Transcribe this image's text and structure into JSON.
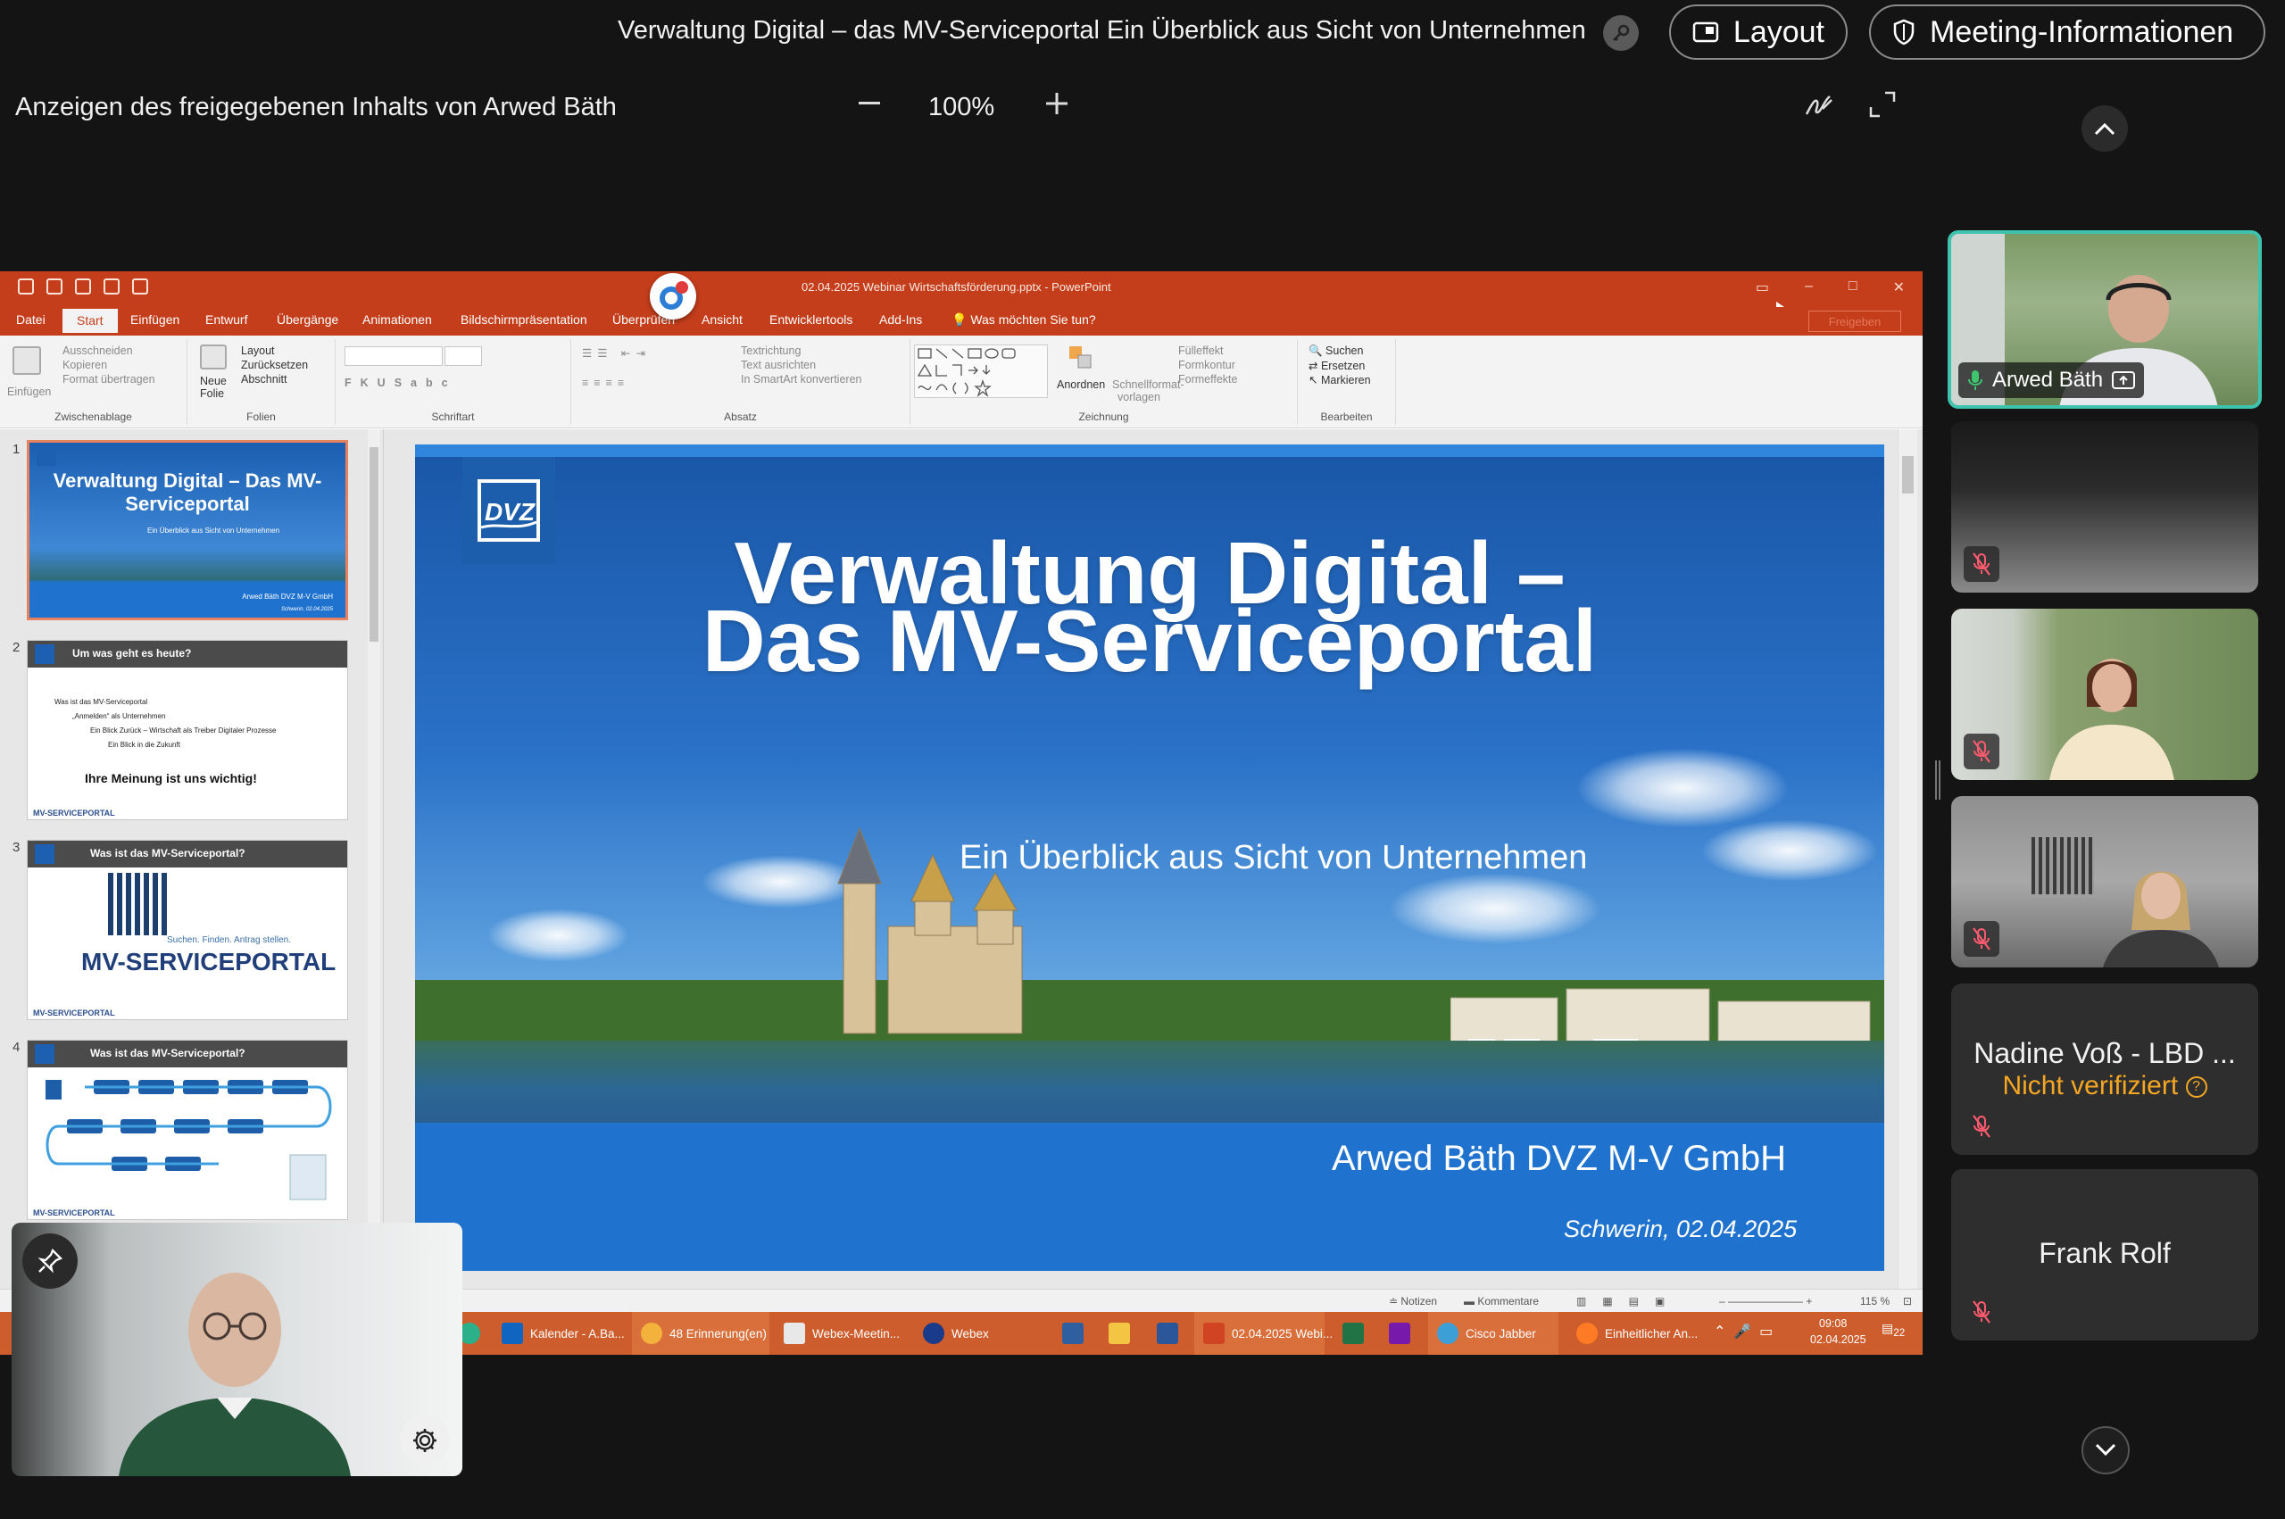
{
  "webex": {
    "meeting_title": "Verwaltung Digital – das MV-Serviceportal Ein Überblick aus Sicht von Unternehmen",
    "layout_label": "Layout",
    "meeting_info_label": "Meeting-Informationen",
    "share_label": "Anzeigen des freigegebenen Inhalts von Arwed Bäth",
    "zoom": "100%"
  },
  "powerpoint": {
    "file_title": "02.04.2025 Webinar Wirtschaftsförderung.pptx - PowerPoint",
    "tabs": [
      "Datei",
      "Start",
      "Einfügen",
      "Entwurf",
      "Übergänge",
      "Animationen",
      "Bildschirmpräsentation",
      "Überprüfen",
      "Ansicht",
      "Entwicklertools",
      "Add-Ins",
      "Was möchten Sie tun?"
    ],
    "share_button": "Freigeben",
    "ribbon": {
      "clipboard": {
        "paste": "Einfügen",
        "cut": "Ausschneiden",
        "copy": "Kopieren",
        "format": "Format übertragen",
        "label": "Zwischenablage"
      },
      "slides": {
        "new": "Neue Folie",
        "layout": "Layout",
        "reset": "Zurücksetzen",
        "section": "Abschnitt",
        "label": "Folien"
      },
      "font": {
        "label": "Schriftart"
      },
      "paragraph": {
        "direction": "Textrichtung",
        "align": "Text ausrichten",
        "smartart": "In SmartArt konvertieren",
        "label": "Absatz"
      },
      "drawing": {
        "arrange": "Anordnen",
        "quickstyles": "Schnellformat-vorlagen",
        "fill": "Fülleffekt",
        "outline": "Formkontur",
        "effects": "Formeffekte",
        "label": "Zeichnung"
      },
      "editing": {
        "find": "Suchen",
        "replace": "Ersetzen",
        "select": "Markieren",
        "label": "Bearbeiten"
      }
    },
    "thumbnails": [
      {
        "num": "1",
        "title": "Verwaltung Digital – Das MV-Serviceportal",
        "subtitle": "Ein Überblick aus Sicht von Unternehmen",
        "author": "Arwed Bäth DVZ M-V GmbH",
        "date": "Schwerin, 02.04.2025"
      },
      {
        "num": "2",
        "bar": "Um was geht es heute?",
        "b1": "Was ist das MV-Serviceportal",
        "b2": "„Anmelden“ als Unternehmen",
        "b3": "Ein Blick Zurück – Wirtschaft als Treiber Digitaler Prozesse",
        "b4": "Ein Blick in die Zukunft",
        "cta": "Ihre Meinung ist uns wichtig!",
        "footer": "MV-SERVICEPORTAL"
      },
      {
        "num": "3",
        "bar": "Was ist das MV-Serviceportal?",
        "tagline": "Suchen. Finden. Antrag stellen.",
        "brand": "MV-SERVICEPORTAL",
        "footer": "MV-SERVICEPORTAL"
      },
      {
        "num": "4",
        "bar": "Was ist das MV-Serviceportal?",
        "footer": "MV-SERVICEPORTAL"
      }
    ],
    "slide": {
      "title_line1": "Verwaltung Digital –",
      "title_line2": "Das MV-Serviceportal",
      "subtitle": "Ein Überblick aus Sicht von Unternehmen",
      "author": "Arwed Bäth DVZ M-V GmbH",
      "date": "Schwerin, 02.04.2025"
    },
    "status": {
      "notes": "Notizen",
      "comments": "Kommentare",
      "zoom": "115 %"
    }
  },
  "taskbar": {
    "items": [
      "Kalender - A.Ba...",
      "48 Erinnerung(en)",
      "Webex-Meetin...",
      "Webex",
      "02.04.2025 Webi...",
      "Cisco Jabber",
      "Einheitlicher An..."
    ],
    "time": "09:08",
    "date": "02.04.2025",
    "notif_count": "22"
  },
  "participants": [
    {
      "name": "Arwed Bäth",
      "active": true
    },
    {
      "name": "",
      "active": false
    },
    {
      "name": "",
      "active": false
    },
    {
      "name": "",
      "active": false
    },
    {
      "name": "Nadine Voß - LBD ...",
      "status": "Nicht verifiziert",
      "active": false
    },
    {
      "name": "Frank Rolf",
      "active": false
    }
  ],
  "colors": {
    "accent": "#3ec4ae",
    "ppt_orange": "#c43e1c",
    "slide_blue": "#1f73cf",
    "warning": "#f5a623"
  }
}
